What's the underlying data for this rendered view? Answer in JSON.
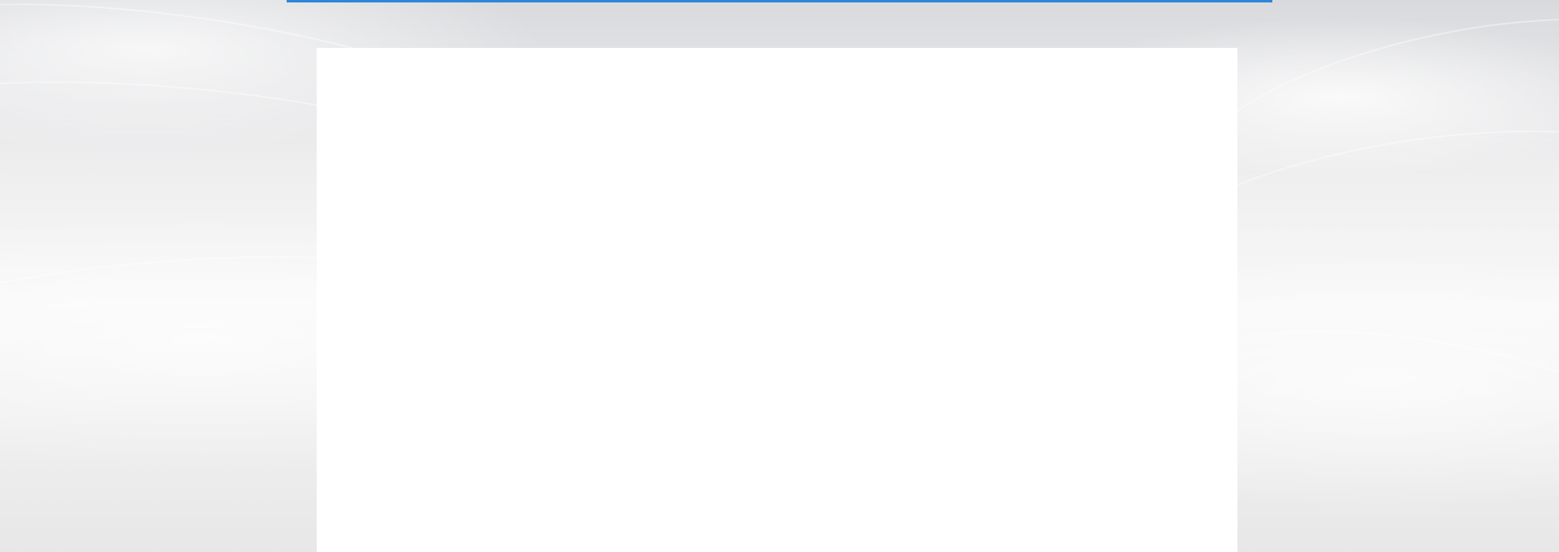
{
  "page": {
    "headline_fragment": "",
    "colors": {
      "accent": "#2f86d6",
      "panel": "#ffffff",
      "background": "#e7e8ea"
    }
  }
}
